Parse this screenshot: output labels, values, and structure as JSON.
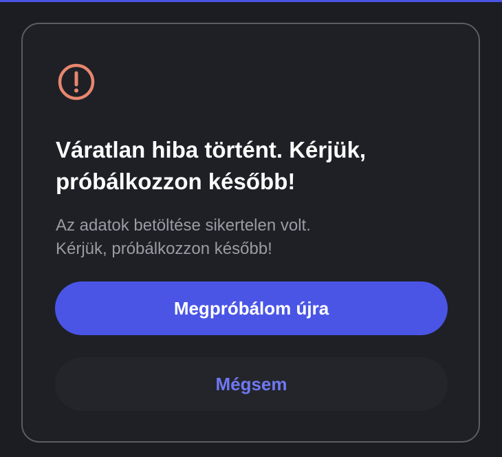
{
  "colors": {
    "accent": "#4a55e6",
    "warning": "#e8866f",
    "background": "#1b1d22",
    "dialog_background": "#1e2026"
  },
  "dialog": {
    "icon": "exclamation-circle-icon",
    "title": "Váratlan hiba történt. Kérjük, próbálkozzon később!",
    "message_line1": "Az adatok betöltése sikertelen volt.",
    "message_line2": "Kérjük, próbálkozzon később!",
    "retry_label": "Megpróbálom újra",
    "cancel_label": "Mégsem"
  }
}
